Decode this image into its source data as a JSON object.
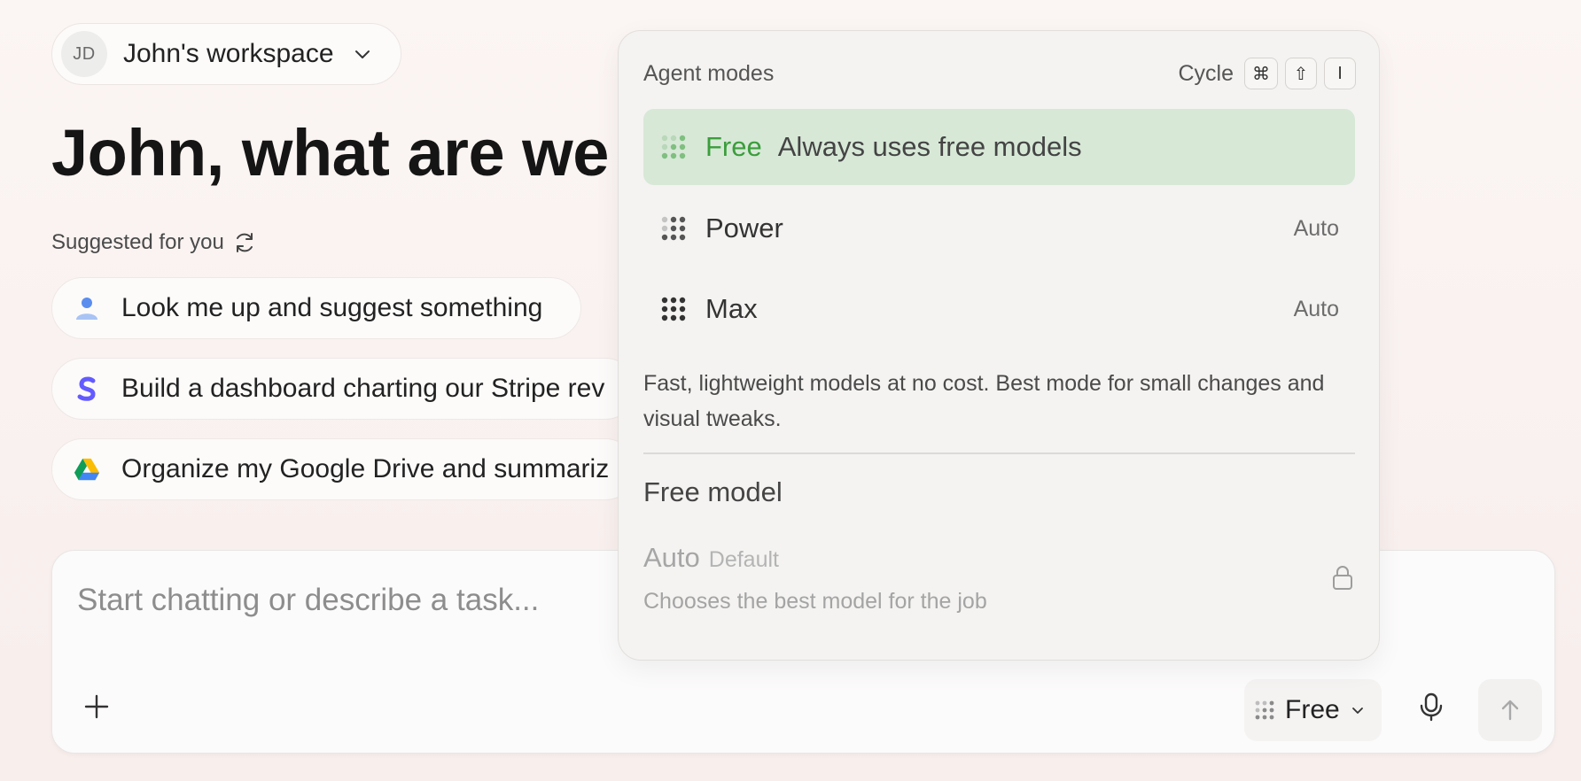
{
  "workspace": {
    "initials": "JD",
    "name": "John's workspace"
  },
  "heading": "John, what are we w",
  "suggested": {
    "label": "Suggested for you",
    "items": [
      {
        "label": "Look me up and suggest something",
        "icon": "user-icon"
      },
      {
        "label": "Build a dashboard charting our Stripe rev",
        "icon": "stripe-icon"
      },
      {
        "label": "Organize my Google Drive and summariz",
        "icon": "google-drive-icon"
      }
    ]
  },
  "chat": {
    "placeholder": "Start chatting or describe a task...",
    "mode_label": "Free"
  },
  "popover": {
    "title": "Agent modes",
    "cycle_label": "Cycle",
    "shortcut_keys": [
      "⌘",
      "⇧",
      "I"
    ],
    "modes": [
      {
        "name": "Free",
        "description": "Always uses free models",
        "badge": ""
      },
      {
        "name": "Power",
        "description": "",
        "badge": "Auto"
      },
      {
        "name": "Max",
        "description": "",
        "badge": "Auto"
      }
    ],
    "info": "Fast, lightweight models at no cost. Best mode for small changes and visual tweaks.",
    "model_heading": "Free model",
    "model_option": {
      "title": "Auto",
      "tag": "Default",
      "description": "Chooses the best model for the job"
    }
  },
  "colors": {
    "accent_green": "#3b9d3b",
    "selected_bg": "#d7e8d7",
    "stripe": "#635bff"
  }
}
